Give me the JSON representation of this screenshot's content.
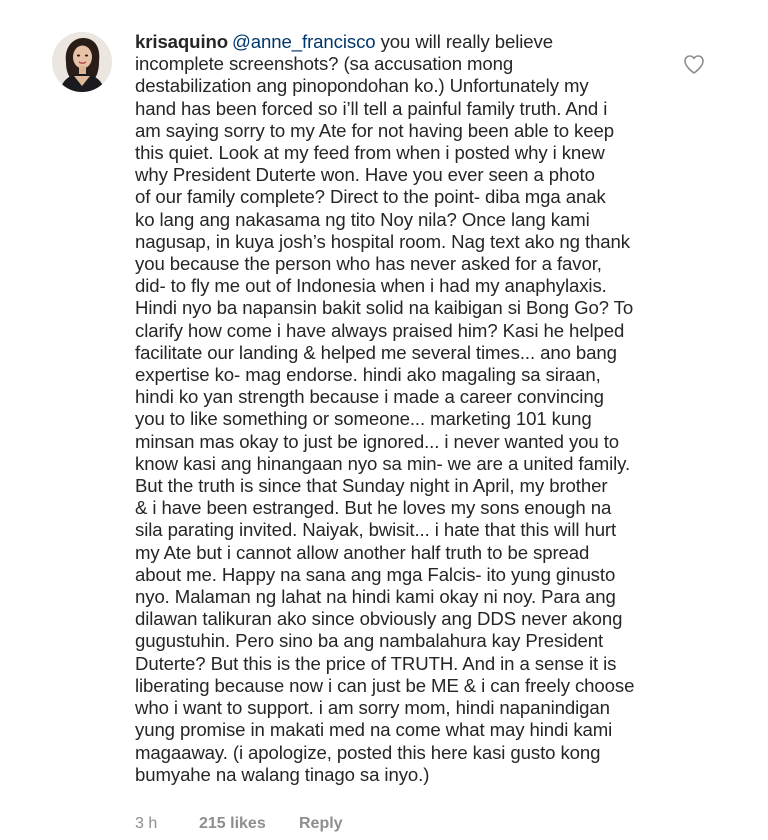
{
  "comment": {
    "username": "krisaquino",
    "mention": "@anne_francisco",
    "text": " you will really believe\nincomplete screenshots? (sa accusation mong\ndestabilization ang pinopondohan ko.) Unfortunately my\nhand has been forced so i’ll tell a painful family truth. And i\nam saying sorry to my Ate for not having been able to keep\nthis quiet. Look at my feed from when i posted why i knew\nwhy President Duterte won. Have you ever seen a photo\nof our family complete? Direct to the point- diba mga anak\nko lang ang nakasama ng tito Noy nila? Once lang kami\nnagusap, in kuya josh’s hospital room. Nag text ako ng thank\nyou because the person who has never asked for a favor,\ndid- to fly me out of Indonesia when i had my anaphylaxis.\nHindi nyo ba napansin bakit solid na kaibigan si Bong Go? To\nclarify how come i have always praised him? Kasi he helped\nfacilitate our landing & helped me several times... ano bang\nexpertise ko- mag endorse. hindi ako magaling sa siraan,\nhindi ko yan strength because i made a career convincing\nyou to like something or someone... marketing 101 kung\nminsan mas okay to just be ignored... i never wanted you to\nknow kasi ang hinangaan nyo sa min- we are a united family.\nBut the truth is since that Sunday night in April, my brother\n& i have been estranged. But he loves my sons enough na\nsila parating invited. Naiyak, bwisit... i hate that this will hurt\nmy Ate but i cannot allow another half truth to be spread\nabout me. Happy na sana ang mga Falcis- ito yung ginusto\nnyo. Malaman ng lahat na hindi kami okay ni noy. Para ang\ndilawan talikuran ako since obviously ang DDS never akong\ngugustuhin. Pero sino ba ang nambalahura kay President\nDuterte? But this is the price of TRUTH. And in a sense it is\nliberating because now i can just be ME & i can freely choose\nwho i want to support. i am sorry mom, hindi napanindigan\nyung promise in makati med na come what may hindi kami\nmagaaway. (i apologize, posted this here kasi gusto kong\nbumyahe na walang tinago sa inyo.)",
    "time": "3 h",
    "likes": "215 likes",
    "reply_label": "Reply"
  },
  "icons": {
    "like": "heart-outline-icon"
  },
  "colors": {
    "text": "#262626",
    "mention": "#00376b",
    "meta": "#8e8e8e",
    "background": "#ffffff"
  }
}
